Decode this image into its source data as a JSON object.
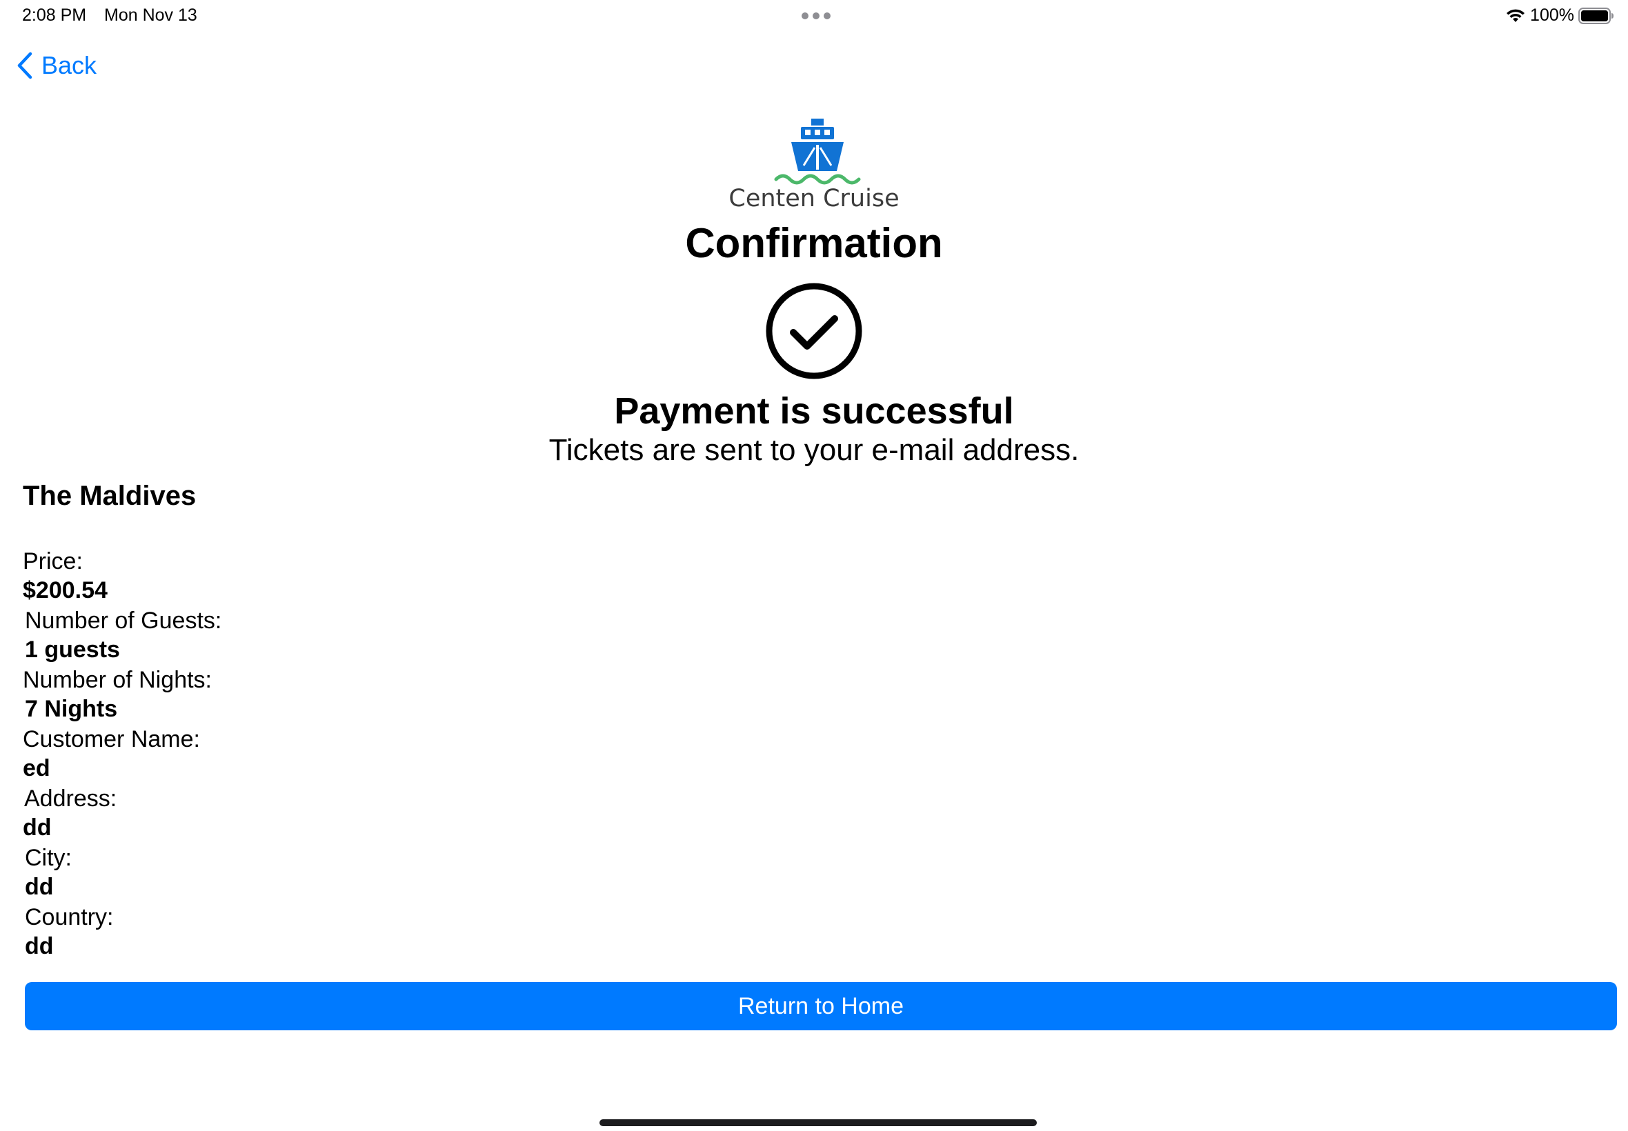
{
  "status_bar": {
    "time": "2:08 PM",
    "date": "Mon Nov 13",
    "battery_percent": "100%",
    "icons": [
      "wifi-icon",
      "battery-icon",
      "multitasking-dots-icon"
    ]
  },
  "nav": {
    "back_label": "Back",
    "back_icon": "chevron-left-icon"
  },
  "header": {
    "brand_name": "Centen Cruise",
    "logo_icon": "cruise-ship-icon",
    "title": "Confirmation",
    "status_icon": "checkmark-circle-icon",
    "success_title": "Payment is successful",
    "success_subtitle": "Tickets are sent to your e-mail address."
  },
  "booking": {
    "destination": "The Maldives",
    "fields": [
      {
        "label": "Price:",
        "value": "$200.54"
      },
      {
        "label": "Number of Guests:",
        "value": "1 guests"
      },
      {
        "label": "Number of Nights:",
        "value": "7 Nights"
      },
      {
        "label": "Customer Name:",
        "value": "ed"
      },
      {
        "label": "Address:",
        "value": "dd"
      },
      {
        "label": "City:",
        "value": "dd"
      },
      {
        "label": "Country:",
        "value": "dd"
      }
    ]
  },
  "actions": {
    "return_home_label": "Return to Home"
  },
  "colors": {
    "accent": "#007aff",
    "logo_blue": "#1173d4",
    "logo_wave_green": "#4cb86a",
    "text": "#000000"
  }
}
